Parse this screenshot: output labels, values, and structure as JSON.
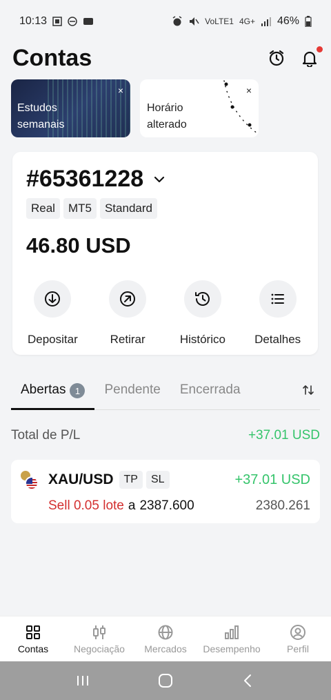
{
  "status": {
    "time": "10:13",
    "net1": "VoLTE1",
    "net2": "4G+",
    "battery": "46%"
  },
  "header": {
    "title": "Contas"
  },
  "promos": [
    {
      "text_line1": "Estudos",
      "text_line2": "semanais",
      "close": "×"
    },
    {
      "text_line1": "Horário",
      "text_line2": "alterado",
      "close": "×"
    }
  ],
  "account": {
    "number": "#65361228",
    "tags": [
      "Real",
      "MT5",
      "Standard"
    ],
    "balance": "46.80 USD",
    "actions": [
      {
        "label": "Depositar",
        "icon": "deposit-icon"
      },
      {
        "label": "Retirar",
        "icon": "withdraw-icon"
      },
      {
        "label": "Histórico",
        "icon": "history-icon"
      },
      {
        "label": "Detalhes",
        "icon": "details-icon"
      }
    ]
  },
  "tabs": {
    "items": [
      {
        "label": "Abertas",
        "badge": "1"
      },
      {
        "label": "Pendente"
      },
      {
        "label": "Encerrada"
      }
    ]
  },
  "total": {
    "label": "Total de P/L",
    "value": "+37.01 USD"
  },
  "position": {
    "symbol": "XAU/USD",
    "tags": [
      "TP",
      "SL"
    ],
    "pl": "+37.01 USD",
    "side": "Sell 0.05 lote",
    "price_prefix": "a",
    "open_price": "2387.600",
    "current_price": "2380.261"
  },
  "nav": {
    "items": [
      {
        "label": "Contas",
        "icon": "accounts-icon",
        "active": true
      },
      {
        "label": "Negociação",
        "icon": "trade-icon"
      },
      {
        "label": "Mercados",
        "icon": "markets-icon"
      },
      {
        "label": "Desempenho",
        "icon": "performance-icon"
      },
      {
        "label": "Perfil",
        "icon": "profile-icon"
      }
    ]
  },
  "colors": {
    "accent_green": "#35c46b",
    "sell_red": "#d32f2f",
    "notification_red": "#e53935"
  }
}
